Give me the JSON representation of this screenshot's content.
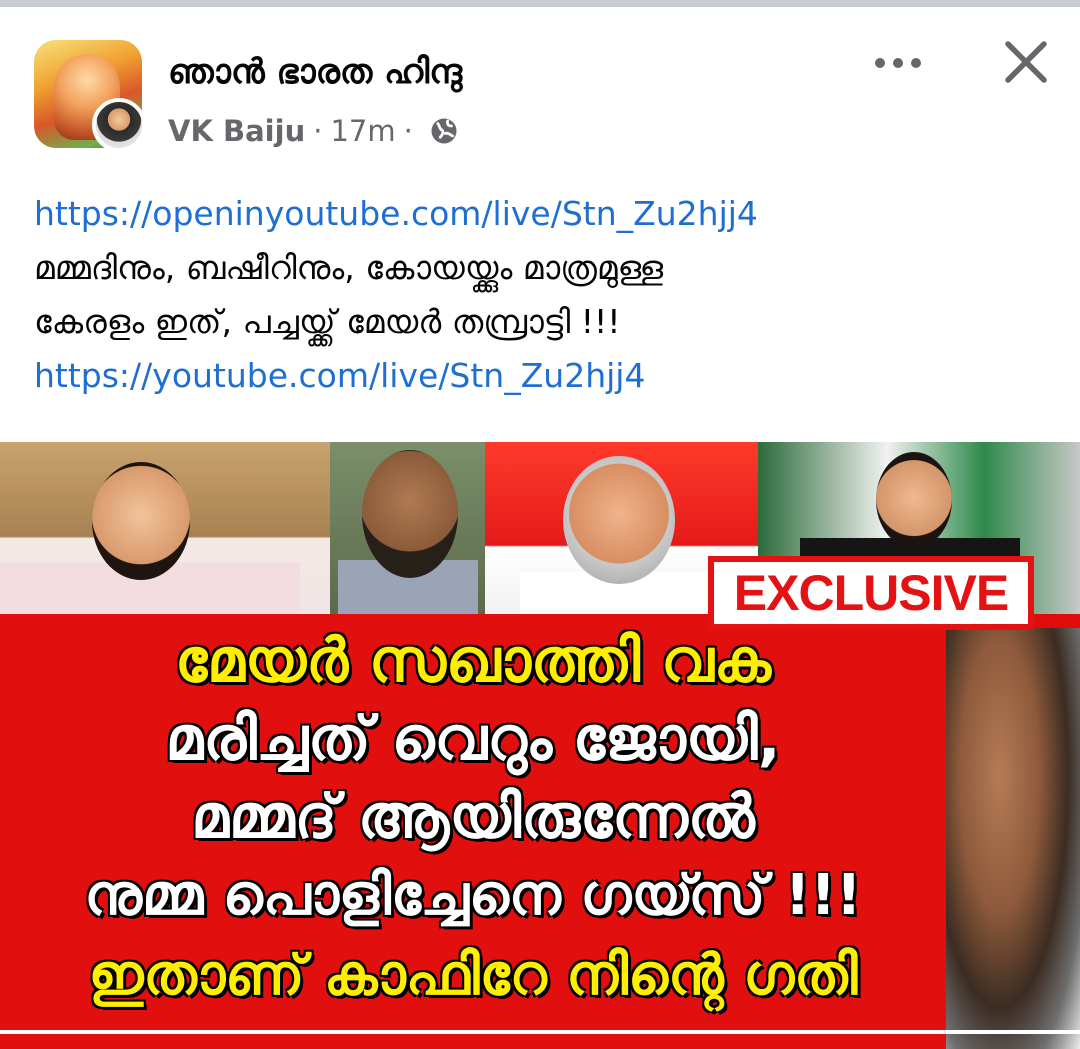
{
  "post": {
    "group_name": "ഞാൻ ഭാരത ഹിന്ദു",
    "author": "VK Baiju",
    "separator": "·",
    "time": "17m",
    "link1": "https://openinyoutube.com/live/Stn_Zu2hjj4",
    "text_line1": "മമ്മദിനും, ബഷീറിനും, കോയയ്ക്കും മാത്രമുള്ള",
    "text_line2": "കേരളം ഇത്, പച്ചയ്ക്ക് മേയർ തമ്പ്രാട്ടി !!!",
    "link2": "https://youtube.com/live/Stn_Zu2hjj4"
  },
  "icons": {
    "more": "more-horizontal-icon",
    "close": "close-icon",
    "privacy": "globe-icon"
  },
  "image": {
    "badge": "EXCLUSIVE",
    "headline": [
      "മേയർ സഖാത്തി വക",
      "മരിച്ചത് വെറും ജോയി,",
      "മമ്മദ് ആയിരുന്നേൽ",
      "നുമ്മ പൊളിച്ചേനെ ഗയ്സ് !!!",
      "ഇതാണ് കാഫിറേ നിന്റെ ഗതി"
    ]
  },
  "colors": {
    "link": "#1f6fd2",
    "meta": "#65676b",
    "headline_red": "#e20f0f",
    "headline_yellow": "#ffee00"
  }
}
